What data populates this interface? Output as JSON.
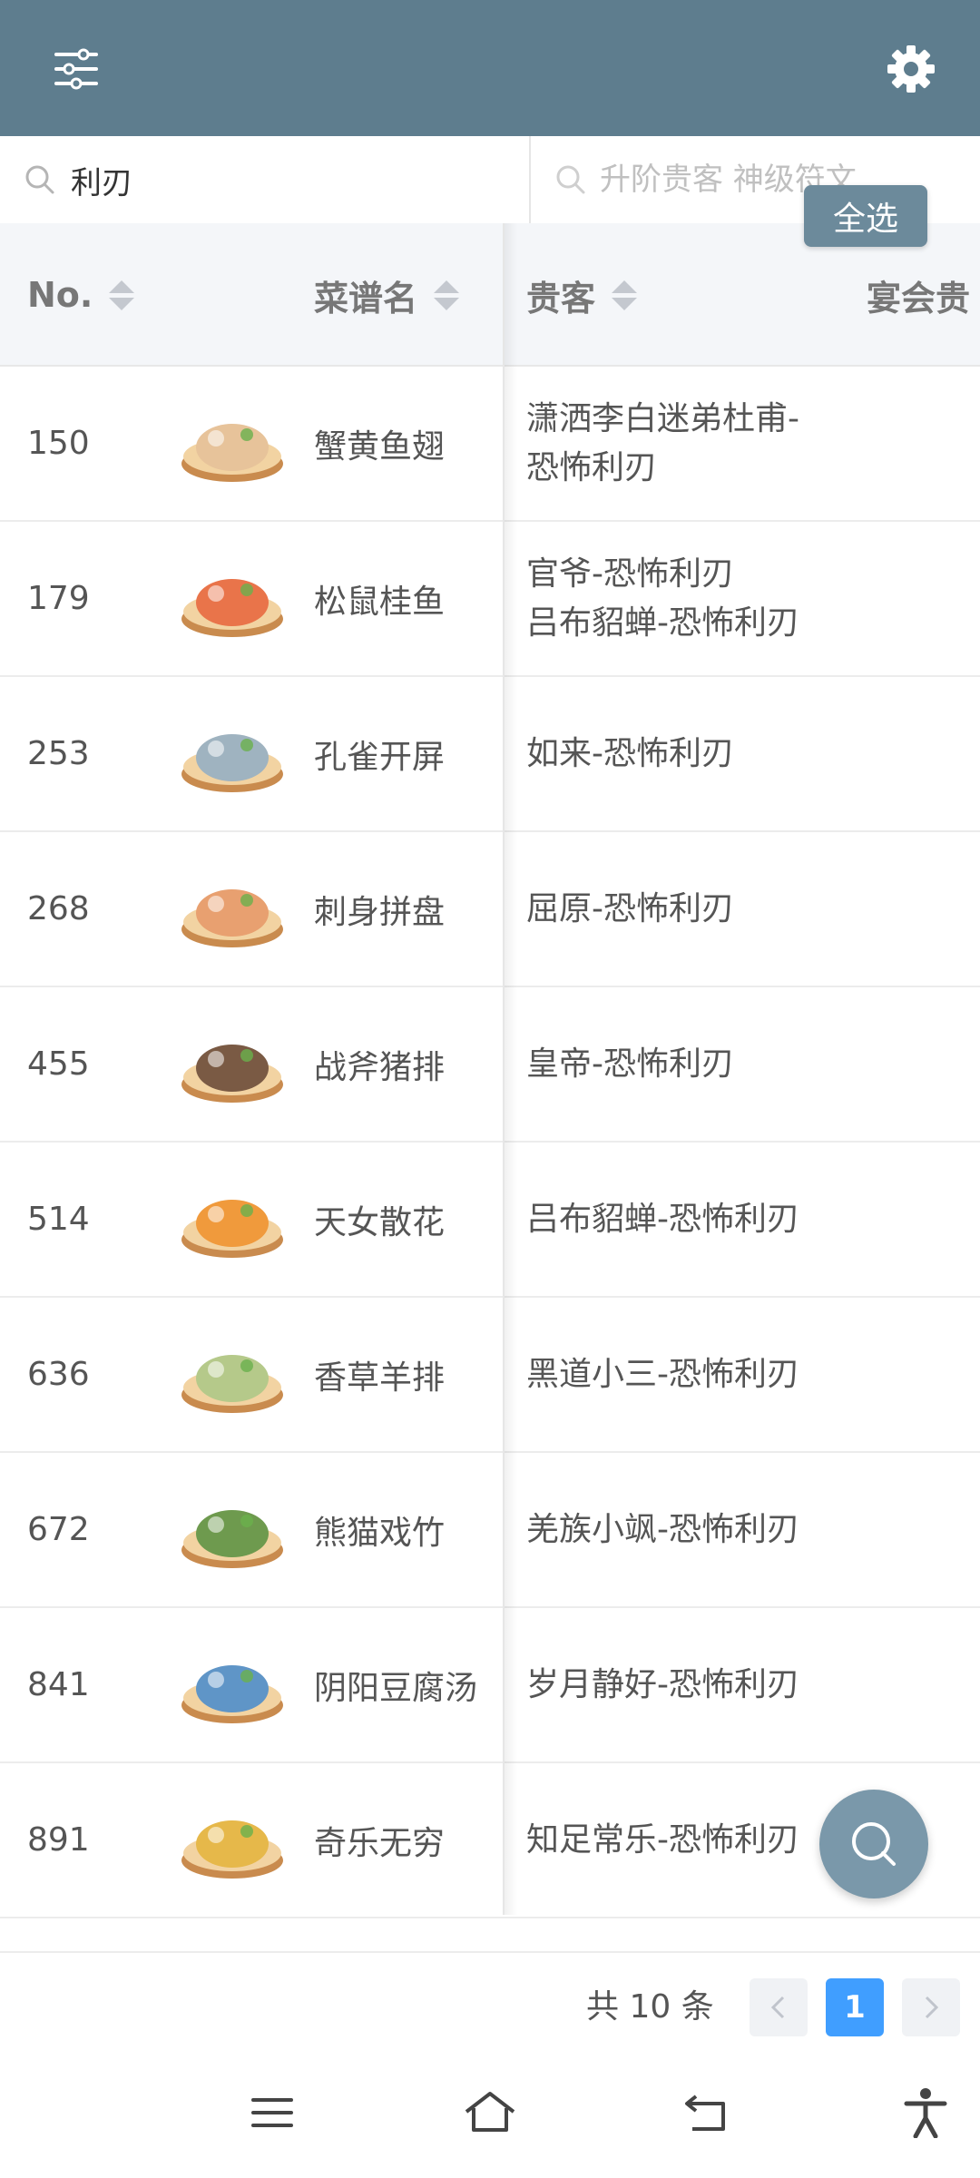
{
  "topbar": {
    "filter_icon": "filter-sliders-icon",
    "settings_icon": "gear-icon",
    "color": "#5e7d8e"
  },
  "search": {
    "value": "利刃",
    "placeholder2": "升阶贵客 神级符文",
    "select_all": "全选"
  },
  "table": {
    "headers": {
      "no": "No.",
      "recipe": "菜谱名",
      "guest": "贵客",
      "banquet": "宴会贵"
    },
    "rows": [
      {
        "no": "150",
        "name": "蟹黄鱼翅",
        "guest1": "潇洒李白迷弟杜甫-",
        "guest2": "恐怖利刃",
        "img_color": "#e7c39a"
      },
      {
        "no": "179",
        "name": "松鼠桂鱼",
        "guest1": "官爷-恐怖利刃",
        "guest2": "吕布貂蝉-恐怖利刃",
        "img_color": "#e9744a"
      },
      {
        "no": "253",
        "name": "孔雀开屏",
        "guest1": "如来-恐怖利刃",
        "guest2": "",
        "img_color": "#9fb3c0"
      },
      {
        "no": "268",
        "name": "刺身拼盘",
        "guest1": "屈原-恐怖利刃",
        "guest2": "",
        "img_color": "#e8a070"
      },
      {
        "no": "455",
        "name": "战斧猪排",
        "guest1": "皇帝-恐怖利刃",
        "guest2": "",
        "img_color": "#7a5a44"
      },
      {
        "no": "514",
        "name": "天女散花",
        "guest1": "吕布貂蝉-恐怖利刃",
        "guest2": "",
        "img_color": "#f09a3c"
      },
      {
        "no": "636",
        "name": "香草羊排",
        "guest1": "黑道小三-恐怖利刃",
        "guest2": "",
        "img_color": "#b5c98a"
      },
      {
        "no": "672",
        "name": "熊猫戏竹",
        "guest1": "羌族小飒-恐怖利刃",
        "guest2": "",
        "img_color": "#6e9a4e"
      },
      {
        "no": "841",
        "name": "阴阳豆腐汤",
        "guest1": "岁月静好-恐怖利刃",
        "guest2": "",
        "img_color": "#5f95c7"
      },
      {
        "no": "891",
        "name": "奇乐无穷",
        "guest1": "知足常乐-恐怖利刃",
        "guest2": "",
        "img_color": "#e6b84a"
      }
    ]
  },
  "fab": {
    "icon": "search-icon"
  },
  "pagination": {
    "total": "共 10 条",
    "current": "1",
    "prev_icon": "chevron-left-icon",
    "next_icon": "chevron-right-icon"
  },
  "sysnav": {
    "menu_icon": "menu-icon",
    "home_icon": "home-icon",
    "back_icon": "back-icon",
    "access_icon": "accessibility-icon"
  }
}
